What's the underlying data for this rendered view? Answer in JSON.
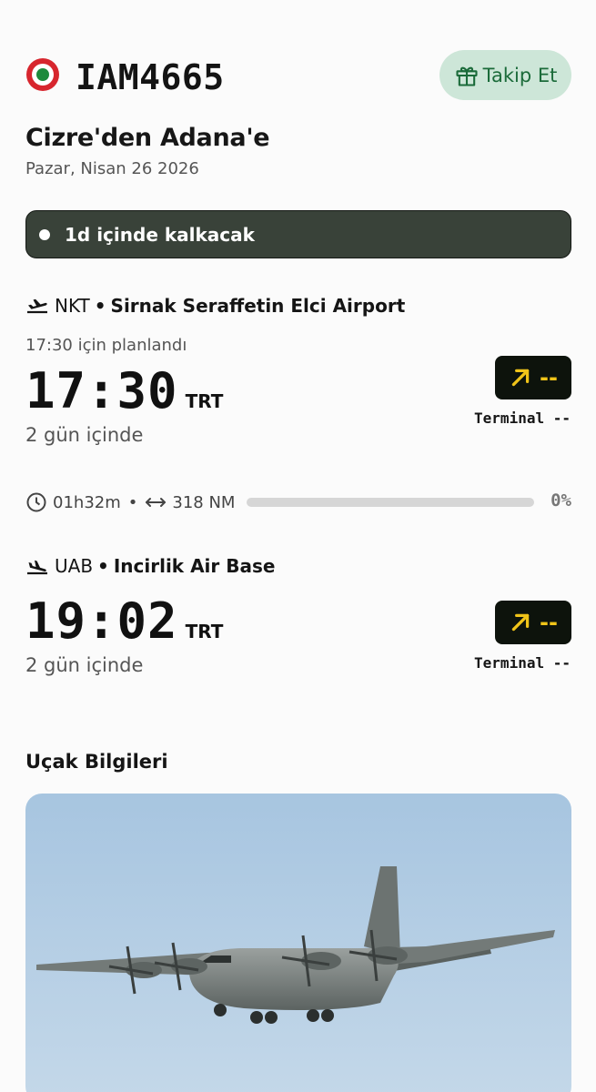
{
  "flight": {
    "number": "IAM4665",
    "track_label": "Takip Et",
    "route": "Cizre'den Adana'e",
    "date": "Pazar, Nisan 26 2026",
    "status": "1d içinde kalkacak"
  },
  "departure": {
    "code": "NKT",
    "bullet": "•",
    "airport": "Sirnak Seraffetin Elci Airport",
    "scheduled": "17:30 için planlandı",
    "time": "17:30",
    "tz": "TRT",
    "relative": "2 gün içinde",
    "gate": "--",
    "terminal": "Terminal --"
  },
  "progress": {
    "duration": "01h32m",
    "bullet": "•",
    "distance": "318 NM",
    "percent": "0%",
    "fraction": 0
  },
  "arrival": {
    "code": "UAB",
    "bullet": "•",
    "airport": "Incirlik Air Base",
    "time": "19:02",
    "tz": "TRT",
    "relative": "2 gün içinde",
    "gate": "--",
    "terminal": "Terminal --"
  },
  "aircraft": {
    "section_title": "Uçak Bilgileri"
  },
  "colors": {
    "accent_green": "#1b6b3a",
    "track_button_bg": "#cde6d8",
    "status_bar_bg": "#394239",
    "gate_badge_bg": "#0d130c",
    "gate_badge_fg": "#f0c419",
    "roundel_outer": "#d7262e",
    "roundel_mid": "#ffffff",
    "roundel_inner": "#1e8a3c"
  }
}
